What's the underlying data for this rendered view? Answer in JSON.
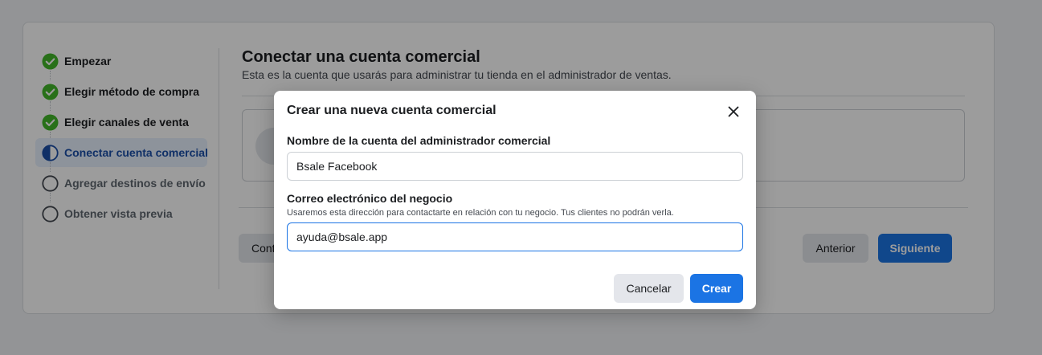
{
  "steps": [
    {
      "label": "Empezar",
      "state": "done"
    },
    {
      "label": "Elegir método de compra",
      "state": "done"
    },
    {
      "label": "Elegir canales de venta",
      "state": "done"
    },
    {
      "label": "Conectar cuenta comercial",
      "state": "active"
    },
    {
      "label": "Agregar destinos de envío",
      "state": "todo"
    },
    {
      "label": "Obtener vista previa",
      "state": "todo"
    }
  ],
  "main": {
    "title": "Conectar una cuenta comercial",
    "subtitle": "Esta es la cuenta que usarás para administrar tu tienda en el administrador de ventas.",
    "continue_button": "Cont",
    "previous_button": "Anterior",
    "next_button": "Siguiente"
  },
  "modal": {
    "title": "Crear una nueva cuenta comercial",
    "close_icon": "close-icon",
    "account_name_label": "Nombre de la cuenta del administrador comercial",
    "account_name_value": "Bsale Facebook",
    "email_label": "Correo electrónico del negocio",
    "email_help": "Usaremos esta dirección para contactarte en relación con tu negocio. Tus clientes no podrán verla.",
    "email_value": "ayuda@bsale.app",
    "cancel_button": "Cancelar",
    "create_button": "Crear"
  },
  "colors": {
    "accent": "#1b74e4",
    "done_green": "#42b72a",
    "active_blue": "#1b4fa8",
    "active_bg": "#e7f0fd"
  }
}
